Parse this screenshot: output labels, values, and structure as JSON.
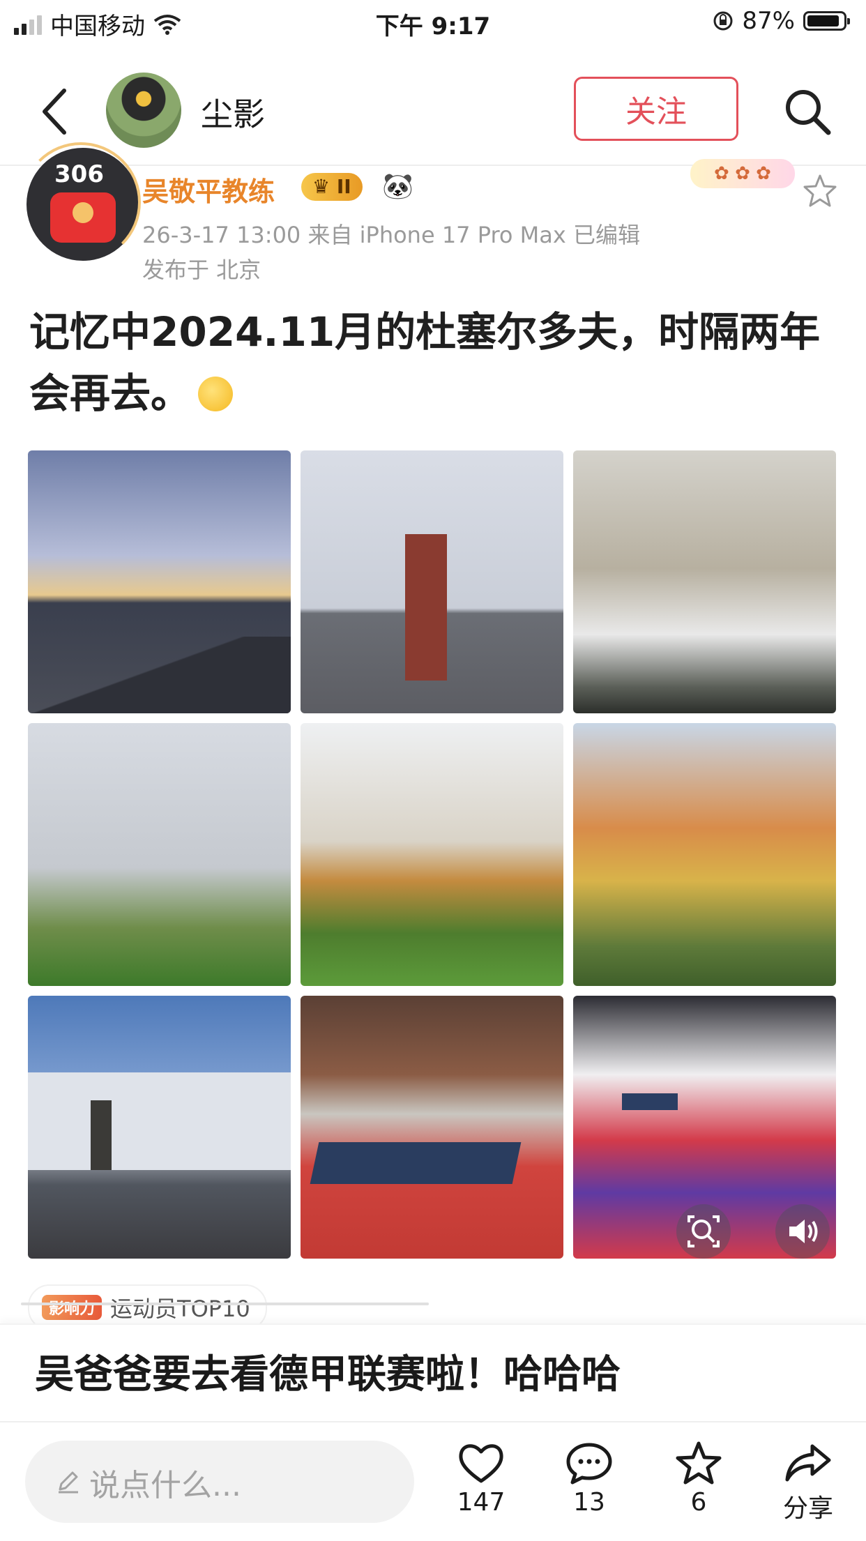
{
  "status_bar": {
    "carrier": "中国移动",
    "time": "下午 9:17",
    "battery": "87%",
    "battery_level": 0.87
  },
  "nav": {
    "name": "尘影",
    "follow_label": "关注"
  },
  "post": {
    "avatar_count": "306",
    "author": "吴敬平教练",
    "vip_level": "II",
    "meta": "26-3-17 13:00  来自 iPhone 17 Pro Max  已编辑",
    "location": "发布于 北京",
    "text": "记忆中2024.11月的杜塞尔多夫，时隔两年会再去。",
    "photos": [
      {
        "name": "street-sunset-photo"
      },
      {
        "name": "brick-tower-photo"
      },
      {
        "name": "snowy-roof-photo"
      },
      {
        "name": "bare-trees-park-photo"
      },
      {
        "name": "white-villa-photo"
      },
      {
        "name": "autumn-tree-photo"
      },
      {
        "name": "table-tennis-center-photo"
      },
      {
        "name": "table-tennis-hall-photo"
      },
      {
        "name": "table-tennis-court-photo"
      }
    ],
    "influence_badge": "影响力",
    "influence_label": "运动员TOP10"
  },
  "reply_text": "吴爸爸要去看德甲联赛啦！哈哈哈",
  "bottom_bar": {
    "comment_placeholder": "说点什么...",
    "likes": "147",
    "comments": "13",
    "favorites": "6",
    "share_label": "分享"
  },
  "colors": {
    "accent": "#e3505a",
    "author": "#e8852a",
    "meta": "#9a9a9a"
  },
  "icons": [
    "signal-icon",
    "wifi-icon",
    "lock-rotation-icon",
    "battery-icon",
    "back-icon",
    "search-icon",
    "star-icon",
    "zoom-icon",
    "sound-icon",
    "pencil-icon",
    "heart-icon",
    "comment-icon",
    "share-icon"
  ]
}
